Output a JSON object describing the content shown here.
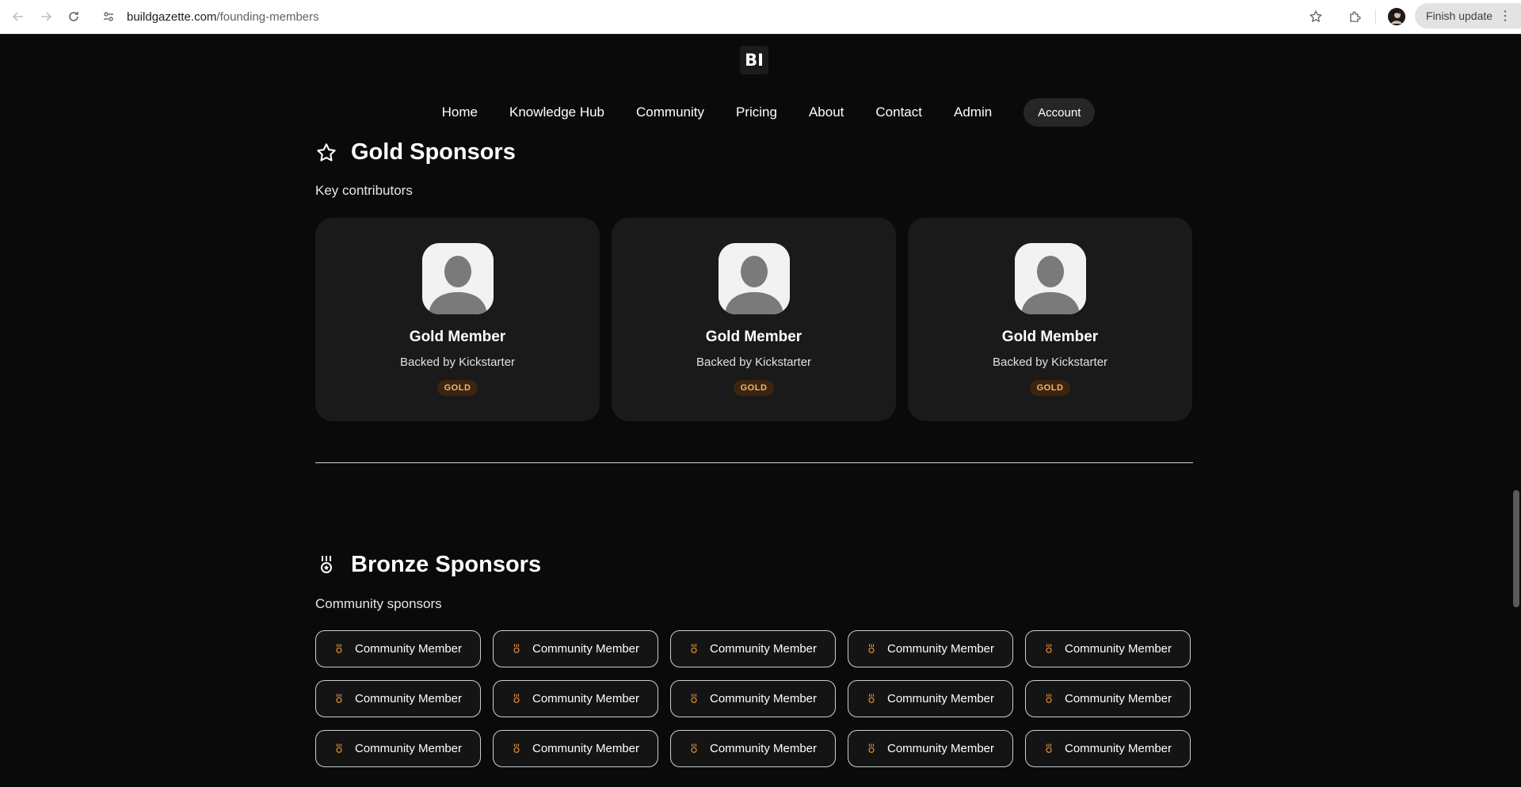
{
  "browser": {
    "url_host": "buildgazette.com",
    "url_path": "/founding-members",
    "finish_update_label": "Finish update"
  },
  "site": {
    "logo_text": "BI",
    "nav": [
      {
        "label": "Home"
      },
      {
        "label": "Knowledge Hub"
      },
      {
        "label": "Community"
      },
      {
        "label": "Pricing"
      },
      {
        "label": "About"
      },
      {
        "label": "Contact"
      },
      {
        "label": "Admin"
      }
    ],
    "account_label": "Account"
  },
  "gold": {
    "title": "Gold Sponsors",
    "subtitle": "Key contributors",
    "cards": [
      {
        "name": "Gold Member",
        "sub": "Backed by Kickstarter",
        "badge": "GOLD"
      },
      {
        "name": "Gold Member",
        "sub": "Backed by Kickstarter",
        "badge": "GOLD"
      },
      {
        "name": "Gold Member",
        "sub": "Backed by Kickstarter",
        "badge": "GOLD"
      }
    ]
  },
  "bronze": {
    "title": "Bronze Sponsors",
    "subtitle": "Community sponsors",
    "members": [
      "Community Member",
      "Community Member",
      "Community Member",
      "Community Member",
      "Community Member",
      "Community Member",
      "Community Member",
      "Community Member",
      "Community Member",
      "Community Member",
      "Community Member",
      "Community Member",
      "Community Member",
      "Community Member",
      "Community Member"
    ]
  },
  "colors": {
    "background": "#0a0a0a",
    "card": "#1a1a1a",
    "accent_gold": "#f4b667",
    "medal": "#e8923a"
  }
}
